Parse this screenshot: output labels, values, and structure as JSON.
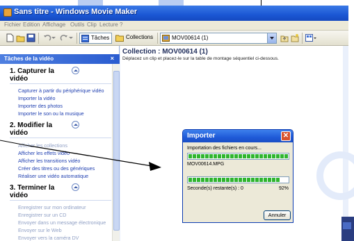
{
  "window": {
    "title": "Sans titre - Windows Movie Maker"
  },
  "menu": {
    "items": [
      "Fichier",
      "Edition",
      "Affichage",
      "Outils",
      "Clip",
      "Lecture",
      "?"
    ]
  },
  "toolbar": {
    "tasks_label": "Tâches",
    "collections_label": "Collections",
    "collection_combo_value": "MOV00614 (1)"
  },
  "task_pane": {
    "header": "Tâches de la vidéo",
    "close_glyph": "×",
    "sections": [
      {
        "title": "1. Capturer la vidéo",
        "links": [
          "Capturer à partir du périphérique vidéo",
          "Importer la vidéo",
          "Importer des photos",
          "Importer le son ou la musique"
        ]
      },
      {
        "title": "2. Modifier la vidéo",
        "links": [
          "Afficher les collections",
          "Afficher les effets vidéo",
          "Afficher les transitions vidéo",
          "Créer des titres ou des génériques",
          "Réaliser une vidéo automatique"
        ]
      },
      {
        "title": "3. Terminer la vidéo",
        "links": [
          "Enregistrer sur mon ordinateur",
          "Enregistrer sur un CD",
          "Envoyer dans un message électronique",
          "Envoyer sur le Web",
          "Envoyer vers la caméra DV"
        ]
      }
    ]
  },
  "collection": {
    "title": "Collection : MOV00614 (1)",
    "subtitle": "Déplacez un clip et placez-le sur la table de montage séquentiel ci-dessous."
  },
  "dialog": {
    "title": "Importer",
    "close_glyph": "✕",
    "status_text": "Importation des fichiers en cours...",
    "file_name": "MOV00614.MPG",
    "remaining_text": "Seconde(s) restante(s) : 0",
    "percent_text": "92%",
    "file_progress": 1.0,
    "total_progress": 0.92,
    "cancel_label": "Annuler"
  },
  "colors": {
    "titlebar": "#1b57d4",
    "link": "#1f3fb0",
    "progress": "#2fb52f"
  }
}
